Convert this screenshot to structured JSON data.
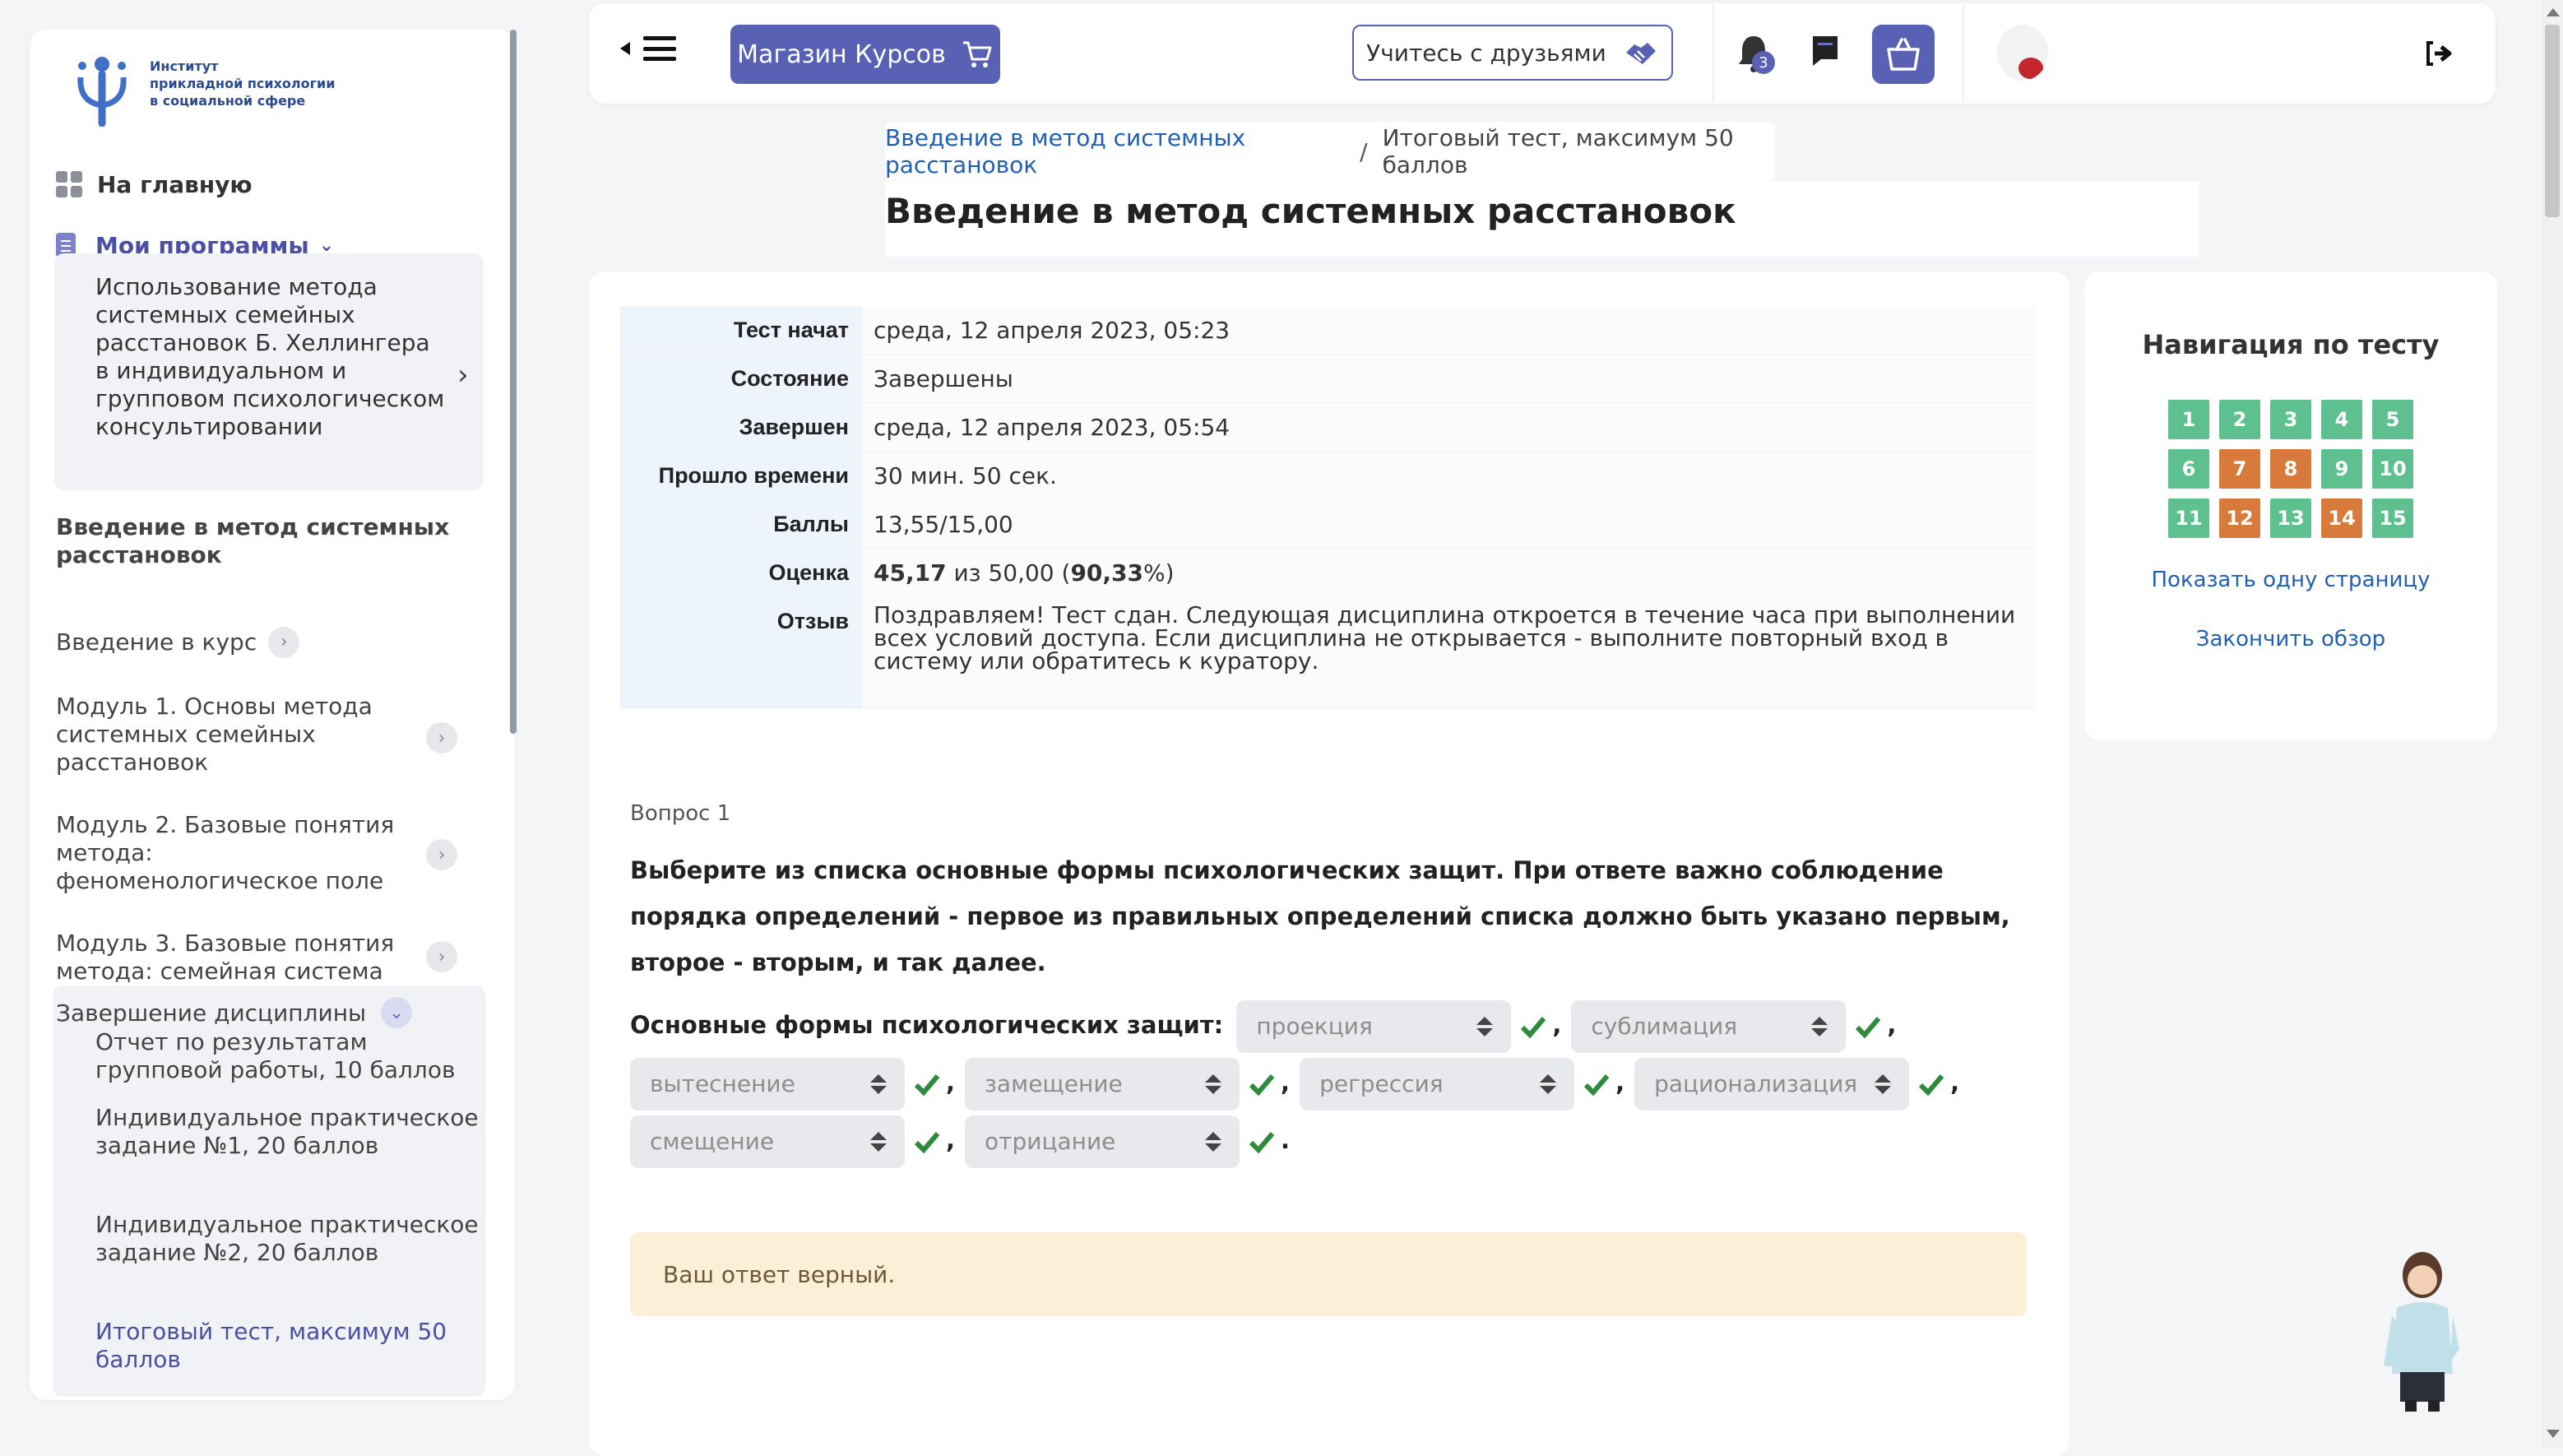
{
  "logo": {
    "text": "Институт\nприкладной психологии\nв социальной сфере"
  },
  "sidebar": {
    "home": "На главную",
    "my_programs": "Мои программы",
    "program_name": "Использование метода системных семейных расстановок Б. Хеллингера в индивидуальном и групповом психологическом консультировании",
    "course_title": "Введение в метод системных расстановок",
    "modules": [
      "Введение в курс",
      "Модуль 1. Основы метода системных семейных расстановок",
      "Модуль 2. Базовые понятия метода: феноменологическое поле",
      "Модуль 3. Базовые понятия метода: семейная система"
    ],
    "final_section": "Завершение дисциплины",
    "final_items": [
      "Отчет по результатам групповой работы, 10 баллов",
      "Индивидуальное практическое задание №1, 20 баллов",
      "Индивидуальное практическое задание №2, 20 баллов",
      "Итоговый тест, максимум 50 баллов"
    ]
  },
  "topbar": {
    "shop_label": "Магазин Курсов",
    "friends_label": "Учитесь с друзьями",
    "notif_count": "3"
  },
  "breadcrumb": {
    "link": "Введение в метод системных расстановок",
    "separator": "/",
    "current": "Итоговый тест, максимум 50 баллов"
  },
  "page_title": "Введение в метод системных расстановок",
  "summary": {
    "started_label": "Тест начат",
    "started": "среда, 12 апреля 2023, 05:23",
    "state_label": "Состояние",
    "state": "Завершены",
    "finished_label": "Завершен",
    "finished": "среда, 12 апреля 2023, 05:54",
    "time_label": "Прошло времени",
    "time": "30 мин. 50 сек.",
    "points_label": "Баллы",
    "points": "13,55/15,00",
    "grade_label": "Оценка",
    "grade_value": "45,17",
    "grade_mid": " из 50,00 (",
    "grade_pct": "90,33",
    "grade_end": "%)",
    "feedback_label": "Отзыв",
    "feedback": "Поздравляем! Тест сдан. Следующая дисциплина откроется в течение часа при выполнении всех условий доступа. Если дисциплина не открывается - выполните повторный вход в систему или обратитесь к куратору."
  },
  "question": {
    "number_label": "Вопрос 1",
    "text": "Выберите из списка основные формы психологических защит. При ответе важно соблюдение порядка определений - первое из правильных определений списка должно быть указано первым, второе - вторым, и так далее.",
    "answers_label": "Основные формы психологических защит:",
    "answers": [
      "проекция",
      "сублимация",
      "вытеснение",
      "замещение",
      "регрессия",
      "рационализация",
      "смещение",
      "отрицание"
    ],
    "comma": ",",
    "period": ".",
    "feedback": "Ваш ответ верный."
  },
  "qnav": {
    "title": "Навигация по тесту",
    "items": [
      {
        "n": "1",
        "state": "ok"
      },
      {
        "n": "2",
        "state": "ok"
      },
      {
        "n": "3",
        "state": "ok"
      },
      {
        "n": "4",
        "state": "ok"
      },
      {
        "n": "5",
        "state": "ok"
      },
      {
        "n": "6",
        "state": "ok"
      },
      {
        "n": "7",
        "state": "part"
      },
      {
        "n": "8",
        "state": "part"
      },
      {
        "n": "9",
        "state": "ok"
      },
      {
        "n": "10",
        "state": "ok"
      },
      {
        "n": "11",
        "state": "ok"
      },
      {
        "n": "12",
        "state": "part"
      },
      {
        "n": "13",
        "state": "ok"
      },
      {
        "n": "14",
        "state": "part"
      },
      {
        "n": "15",
        "state": "ok"
      }
    ],
    "show_one_page": "Показать одну страницу",
    "finish_review": "Закончить обзор"
  },
  "colors": {
    "accent": "#5961b5",
    "correct": "#5fc08f",
    "partial": "#d97a3d",
    "link": "#1f5fb8"
  },
  "icons": [
    "logo-icon",
    "home-grid-icon",
    "programs-icon",
    "chevron-down-icon",
    "chevron-right-icon",
    "menu-icon",
    "cart-icon",
    "handshake-icon",
    "bell-icon",
    "chat-icon",
    "basket-icon",
    "logout-icon",
    "check-icon",
    "select-arrows-icon"
  ]
}
